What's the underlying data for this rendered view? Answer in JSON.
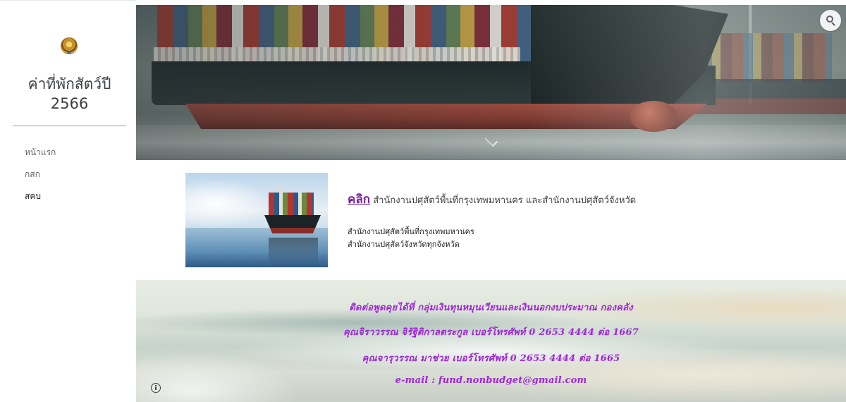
{
  "sidebar": {
    "site_title": "ค่าที่พักสัตว์ปี 2566",
    "nav": [
      {
        "label": "หน้าแรก",
        "active": false
      },
      {
        "label": "กสก",
        "active": false
      },
      {
        "label": "สคบ",
        "active": true
      }
    ]
  },
  "header": {
    "search_icon": "search-icon",
    "scroll_icon": "chevron-down-icon"
  },
  "content": {
    "link_label": "คลิก",
    "heading": " สำนักงานปศุสัตว์พื้นที่กรุงเทพมหานคร และสำนักงานปศุสัตว์จังหวัด",
    "lines": [
      "สำนักงานปศุสัตว์พื้นที่กรุงเทพมหานคร",
      "สำนักงานปศุสัตว์จังหวัดทุกจังหวัด"
    ],
    "link_color": "#7b1fa2"
  },
  "contact": {
    "lines": [
      "ติดต่อพูดคุยได้ที่ กลุ่มเงินทุนหมุนเวียนและเงินนอกงบประมาณ กองคลัง",
      "คุณจิราวรรณ จิรัฐิติกาลตระกูล เบอร์โทรศัพท์ 0 2653 4444 ต่อ 1667",
      "คุณจารุวรรณ มาช่วย เบอร์โทรศัพท์ 0 2653 4444 ต่อ 1665",
      "e-mail : fund.nonbudget@gmail.com"
    ],
    "text_color": "#9c27d6",
    "info_icon": "info-icon"
  }
}
